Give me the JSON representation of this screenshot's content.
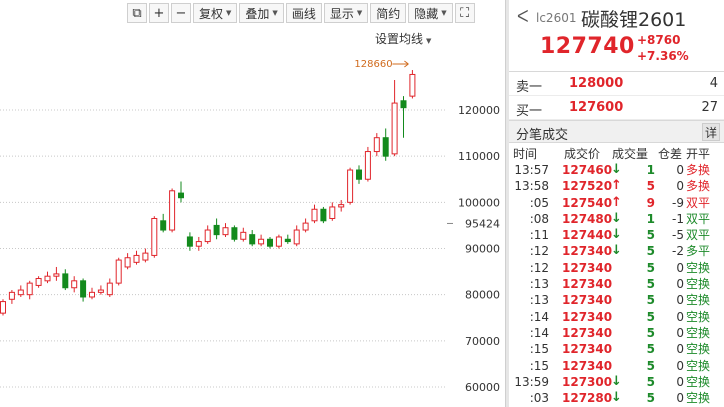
{
  "toolbar": {
    "buttons": [
      {
        "id": "copy",
        "label": "⧉",
        "icon": "copy-icon"
      },
      {
        "id": "zoom_in",
        "label": "+",
        "icon": "plus-icon"
      },
      {
        "id": "zoom_out",
        "label": "−",
        "icon": "minus-icon"
      },
      {
        "id": "adjust",
        "label": "复权",
        "caret": true
      },
      {
        "id": "overlay",
        "label": "叠加",
        "caret": true
      },
      {
        "id": "draw",
        "label": "画线",
        "caret": false
      },
      {
        "id": "display",
        "label": "显示",
        "caret": true
      },
      {
        "id": "simple",
        "label": "简约",
        "caret": false
      },
      {
        "id": "hide",
        "label": "隐藏",
        "caret": true
      },
      {
        "id": "fullscreen",
        "label": "⛶",
        "icon": "fullscreen-icon"
      }
    ],
    "ma_setting": "设置均线"
  },
  "chart_data": {
    "type": "candlestick",
    "y_ticks": [
      "120000",
      "110000",
      "100000",
      "90000",
      "80000",
      "70000",
      "60000"
    ],
    "last_price_label": "95424",
    "high_annotation": "128660",
    "candles": [
      {
        "o": 76000,
        "c": 78500,
        "h": 79000,
        "l": 75500
      },
      {
        "o": 79000,
        "c": 80500,
        "h": 81000,
        "l": 78000
      },
      {
        "o": 80000,
        "c": 81000,
        "h": 82000,
        "l": 79500
      },
      {
        "o": 80000,
        "c": 82500,
        "h": 83000,
        "l": 79000
      },
      {
        "o": 82000,
        "c": 83500,
        "h": 84000,
        "l": 81500
      },
      {
        "o": 83000,
        "c": 84000,
        "h": 85000,
        "l": 82500
      },
      {
        "o": 84000,
        "c": 84500,
        "h": 86000,
        "l": 83000
      },
      {
        "o": 84500,
        "c": 81500,
        "h": 85500,
        "l": 81000
      },
      {
        "o": 81500,
        "c": 83000,
        "h": 84000,
        "l": 80500
      },
      {
        "o": 83000,
        "c": 79500,
        "h": 83500,
        "l": 78500
      },
      {
        "o": 79500,
        "c": 80500,
        "h": 81500,
        "l": 79000
      },
      {
        "o": 80500,
        "c": 81000,
        "h": 82000,
        "l": 80000
      },
      {
        "o": 80000,
        "c": 82500,
        "h": 83500,
        "l": 79500
      },
      {
        "o": 82500,
        "c": 87500,
        "h": 88000,
        "l": 82000
      },
      {
        "o": 86000,
        "c": 88000,
        "h": 89000,
        "l": 85500
      },
      {
        "o": 87000,
        "c": 88500,
        "h": 89500,
        "l": 86500
      },
      {
        "o": 87500,
        "c": 89000,
        "h": 90000,
        "l": 87000
      },
      {
        "o": 88500,
        "c": 96500,
        "h": 97000,
        "l": 88000
      },
      {
        "o": 96000,
        "c": 94000,
        "h": 97500,
        "l": 93500
      },
      {
        "o": 94000,
        "c": 102500,
        "h": 103000,
        "l": 93500
      },
      {
        "o": 102000,
        "c": 101000,
        "h": 104500,
        "l": 100000
      },
      {
        "o": 92500,
        "c": 90500,
        "h": 93500,
        "l": 89500
      },
      {
        "o": 90500,
        "c": 91500,
        "h": 92500,
        "l": 89500
      },
      {
        "o": 91500,
        "c": 94000,
        "h": 95000,
        "l": 91000
      },
      {
        "o": 95000,
        "c": 93000,
        "h": 96500,
        "l": 92000
      },
      {
        "o": 93000,
        "c": 94500,
        "h": 95500,
        "l": 92500
      },
      {
        "o": 94500,
        "c": 92000,
        "h": 95000,
        "l": 91500
      },
      {
        "o": 92000,
        "c": 93500,
        "h": 94500,
        "l": 91500
      },
      {
        "o": 93000,
        "c": 91000,
        "h": 94000,
        "l": 90500
      },
      {
        "o": 91000,
        "c": 92000,
        "h": 93000,
        "l": 90500
      },
      {
        "o": 92000,
        "c": 90500,
        "h": 92500,
        "l": 90000
      },
      {
        "o": 90500,
        "c": 92500,
        "h": 93000,
        "l": 90000
      },
      {
        "o": 92000,
        "c": 91500,
        "h": 93000,
        "l": 91000
      },
      {
        "o": 91000,
        "c": 94000,
        "h": 95000,
        "l": 90500
      },
      {
        "o": 94000,
        "c": 95500,
        "h": 96500,
        "l": 93500
      },
      {
        "o": 96000,
        "c": 98500,
        "h": 99500,
        "l": 95500
      },
      {
        "o": 98500,
        "c": 96000,
        "h": 99000,
        "l": 95500
      },
      {
        "o": 96500,
        "c": 99000,
        "h": 100000,
        "l": 96000
      },
      {
        "o": 99000,
        "c": 99500,
        "h": 100500,
        "l": 98000
      },
      {
        "o": 100000,
        "c": 107000,
        "h": 107500,
        "l": 99500
      },
      {
        "o": 107000,
        "c": 105000,
        "h": 108000,
        "l": 104000
      },
      {
        "o": 105000,
        "c": 111000,
        "h": 112000,
        "l": 104500
      },
      {
        "o": 111000,
        "c": 114000,
        "h": 115000,
        "l": 110000
      },
      {
        "o": 114000,
        "c": 110000,
        "h": 116000,
        "l": 109000
      },
      {
        "o": 110500,
        "c": 121500,
        "h": 126500,
        "l": 110000
      },
      {
        "o": 122000,
        "c": 120500,
        "h": 123000,
        "l": 114000
      },
      {
        "o": 123000,
        "c": 127700,
        "h": 128660,
        "l": 122500
      }
    ]
  },
  "quote": {
    "code": "lc2601",
    "name": "碳酸锂2601",
    "last": "127740",
    "change": "+8760",
    "change_pct": "+7.36%",
    "ask_label": "卖一",
    "ask_price": "128000",
    "ask_vol": "4",
    "bid_label": "买一",
    "bid_price": "127600",
    "bid_vol": "27"
  },
  "ticks": {
    "title": "分笔成交",
    "detail_label": "详",
    "headers": {
      "time": "时间",
      "price": "成交价",
      "vol": "成交量",
      "oi": "仓差",
      "kind": "开平"
    },
    "rows": [
      {
        "time": "13:57",
        "price": "127460",
        "dir": "down",
        "vol": "1",
        "oi": "0",
        "kind": "多换",
        "kind_color": "red"
      },
      {
        "time": "13:58",
        "price": "127520",
        "dir": "up",
        "vol": "5",
        "oi": "0",
        "kind": "多换",
        "kind_color": "red"
      },
      {
        "time": ":05",
        "price": "127540",
        "dir": "up",
        "vol": "9",
        "oi": "-9",
        "kind": "双平",
        "kind_color": "red"
      },
      {
        "time": ":08",
        "price": "127480",
        "dir": "down",
        "vol": "1",
        "oi": "-1",
        "kind": "双平",
        "kind_color": "green"
      },
      {
        "time": ":11",
        "price": "127440",
        "dir": "down",
        "vol": "5",
        "oi": "-5",
        "kind": "双平",
        "kind_color": "green"
      },
      {
        "time": ":12",
        "price": "127340",
        "dir": "down",
        "vol": "5",
        "oi": "-2",
        "kind": "多平",
        "kind_color": "green"
      },
      {
        "time": ":12",
        "price": "127340",
        "dir": "",
        "vol": "5",
        "oi": "0",
        "kind": "空换",
        "kind_color": "green"
      },
      {
        "time": ":13",
        "price": "127340",
        "dir": "",
        "vol": "5",
        "oi": "0",
        "kind": "空换",
        "kind_color": "green"
      },
      {
        "time": ":13",
        "price": "127340",
        "dir": "",
        "vol": "5",
        "oi": "0",
        "kind": "空换",
        "kind_color": "green"
      },
      {
        "time": ":14",
        "price": "127340",
        "dir": "",
        "vol": "5",
        "oi": "0",
        "kind": "空换",
        "kind_color": "green"
      },
      {
        "time": ":14",
        "price": "127340",
        "dir": "",
        "vol": "5",
        "oi": "0",
        "kind": "空换",
        "kind_color": "green"
      },
      {
        "time": ":15",
        "price": "127340",
        "dir": "",
        "vol": "5",
        "oi": "0",
        "kind": "空换",
        "kind_color": "green"
      },
      {
        "time": ":15",
        "price": "127340",
        "dir": "",
        "vol": "5",
        "oi": "0",
        "kind": "空换",
        "kind_color": "green"
      },
      {
        "time": "13:59",
        "price": "127300",
        "dir": "down",
        "vol": "5",
        "oi": "0",
        "kind": "空换",
        "kind_color": "green"
      },
      {
        "time": ":03",
        "price": "127280",
        "dir": "down",
        "vol": "5",
        "oi": "0",
        "kind": "空换",
        "kind_color": "green"
      }
    ]
  }
}
